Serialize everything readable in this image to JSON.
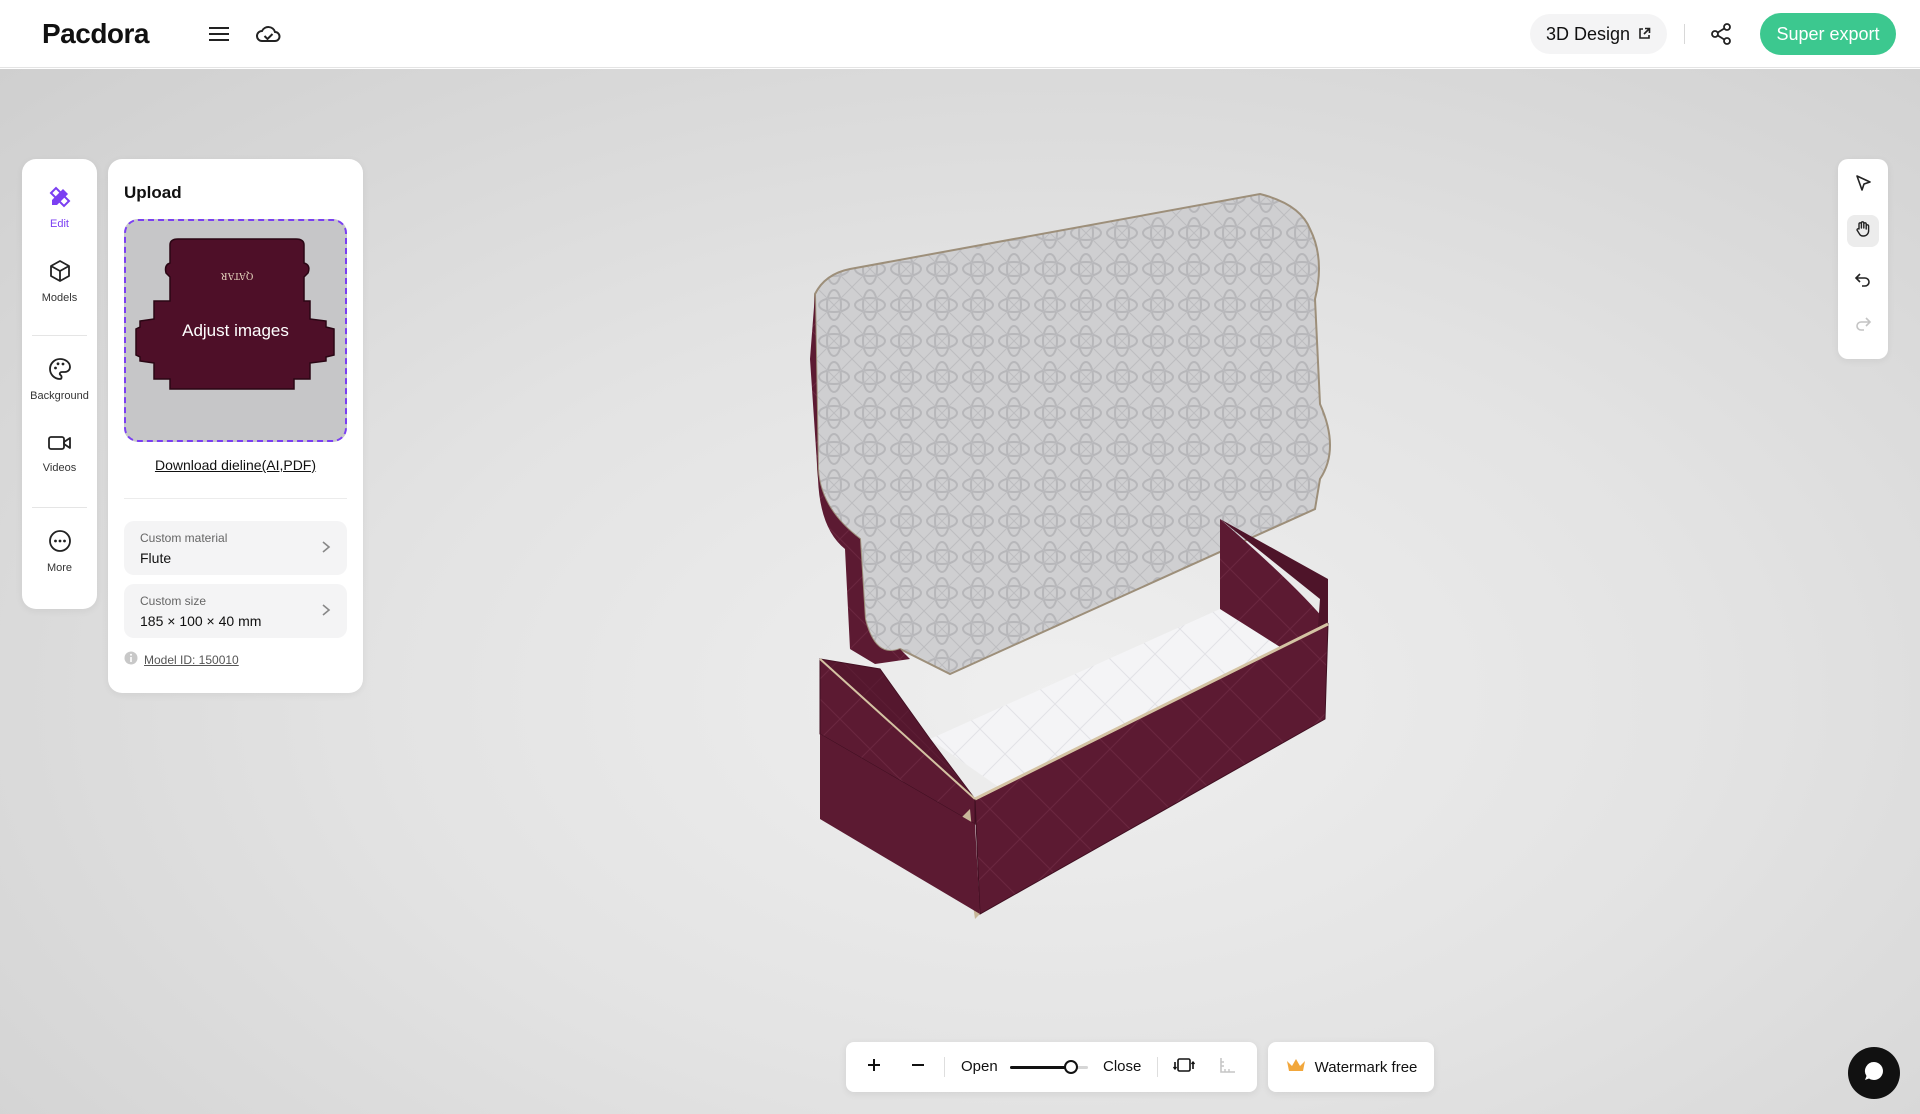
{
  "brand": {
    "logo_text": "Pacdora"
  },
  "header": {
    "design_button_label": "3D Design",
    "export_button_label": "Super export",
    "icons": [
      "menu-icon",
      "cloud-icon",
      "external-link-icon",
      "share-icon"
    ]
  },
  "rail": {
    "items": [
      {
        "label": "Edit",
        "icon": "edit-icon",
        "active": true
      },
      {
        "label": "Models",
        "icon": "cube-icon",
        "active": false
      },
      {
        "label": "Background",
        "icon": "palette-icon",
        "active": false
      },
      {
        "label": "Videos",
        "icon": "video-icon",
        "active": false
      },
      {
        "label": "More",
        "icon": "more-icon",
        "active": false
      }
    ]
  },
  "panel": {
    "title": "Upload",
    "adjust_label": "Adjust images",
    "download_label": "Download dieline(AI,PDF)",
    "material": {
      "label": "Custom material",
      "value": "Flute"
    },
    "size": {
      "label": "Custom size",
      "value": "185 × 100 × 40 mm"
    },
    "model_id": "Model ID: 150010",
    "thumbnail_brand": "QATAR"
  },
  "toolbar": {
    "tools": [
      "pointer-icon",
      "hand-icon",
      "undo-icon",
      "redo-icon"
    ],
    "active_tool": "hand-icon"
  },
  "bottom_bar": {
    "open_label": "Open",
    "close_label": "Close",
    "slider_value": 0.85,
    "watermark_label": "Watermark free"
  },
  "colors": {
    "accent": "#7b3ff2",
    "export_green": "#3cc88f",
    "box_maroon": "#5c1a32",
    "crown": "#f2a73b"
  }
}
